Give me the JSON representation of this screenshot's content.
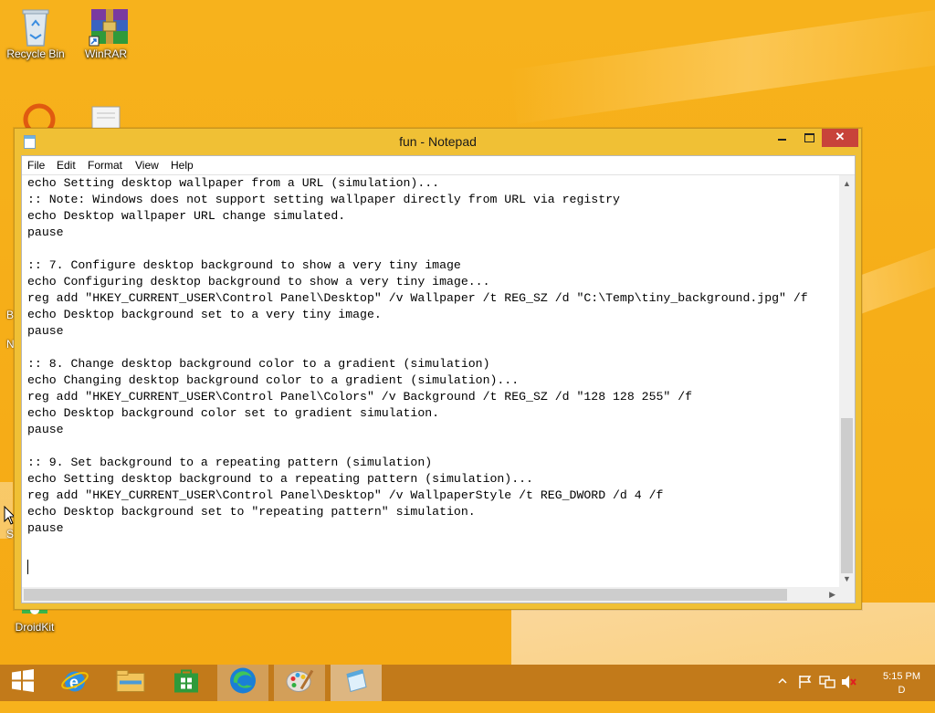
{
  "desktop": {
    "icons": [
      {
        "label": "Recycle Bin"
      },
      {
        "label": "WinRAR"
      },
      {
        "label": "DroidKit"
      }
    ],
    "partial_letters": [
      "B",
      "N",
      "S"
    ]
  },
  "window": {
    "title": "fun - Notepad",
    "close_glyph": "✕",
    "menu": [
      "File",
      "Edit",
      "Format",
      "View",
      "Help"
    ],
    "lines": [
      "echo Setting desktop wallpaper from a URL (simulation)...",
      ":: Note: Windows does not support setting wallpaper directly from URL via registry",
      "echo Desktop wallpaper URL change simulated.",
      "pause",
      "",
      ":: 7. Configure desktop background to show a very tiny image",
      "echo Configuring desktop background to show a very tiny image...",
      "reg add \"HKEY_CURRENT_USER\\Control Panel\\Desktop\" /v Wallpaper /t REG_SZ /d \"C:\\Temp\\tiny_background.jpg\" /f",
      "echo Desktop background set to a very tiny image.",
      "pause",
      "",
      ":: 8. Change desktop background color to a gradient (simulation)",
      "echo Changing desktop background color to a gradient (simulation)...",
      "reg add \"HKEY_CURRENT_USER\\Control Panel\\Colors\" /v Background /t REG_SZ /d \"128 128 255\" /f",
      "echo Desktop background color set to gradient simulation.",
      "pause",
      "",
      ":: 9. Set background to a repeating pattern (simulation)",
      "echo Setting desktop background to a repeating pattern (simulation)...",
      "reg add \"HKEY_CURRENT_USER\\Control Panel\\Desktop\" /v WallpaperStyle /t REG_DWORD /d 4 /f",
      "echo Desktop background set to \"repeating pattern\" simulation.",
      "pause",
      ""
    ]
  },
  "taskbar": {
    "apps": [
      "start",
      "internet-explorer",
      "file-explorer",
      "store",
      "edge",
      "paint",
      "notepad"
    ],
    "clock_time": "5:15 PM",
    "clock_date": "D"
  },
  "colors": {
    "desktop": "#f5ab18",
    "window_frame": "#f0c035",
    "close_button": "#c8433a",
    "taskbar": "#c27a1a"
  }
}
